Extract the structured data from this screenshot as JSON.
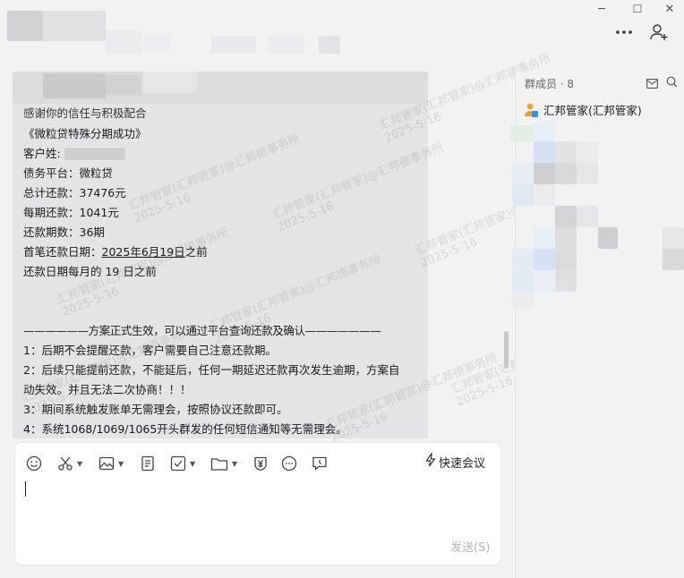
{
  "window": {
    "minimize": "─",
    "maximize": "☐",
    "close": "✕"
  },
  "header": {
    "more_icon": "more-icon",
    "add_member_icon": "add-member-icon"
  },
  "message": {
    "lines": [
      "感谢你的信任与积极配合",
      "《微粒贷特殊分期成功》",
      "客户姓:",
      "债务平台：微粒贷",
      "总计还款：37476元",
      "每期还款：1041元",
      "还款期数：36期",
      "首笔还款日期：",
      "还款日期每月的 19 日之前",
      "——————方案正式生效，可以通过平台查询还款及确认———————",
      "1：后期不会提醒还款，客户需要自己注意还款期。",
      "2：后续只能提前还款，不能延后，任何一期延迟还款再次发生逾期，方案自",
      "动失效。并且无法二次协商！！！",
      "3：期间系统触发账单无需理会，按照协议还款即可。",
      "4：系统1068/1069/1065开头群发的任何短信通知等无需理会。"
    ],
    "first_due_date": "2025年6月19日",
    "first_due_suffix": "之前"
  },
  "watermark": {
    "name": "汇邦管家(汇邦管家)@汇邦德事务所",
    "date": "2025-5-16"
  },
  "sidebar": {
    "title": "群成员 · 8",
    "members": [
      {
        "name": "汇邦管家(汇邦管家)"
      }
    ]
  },
  "composer": {
    "tools": [
      "emoji-icon",
      "scissors-icon",
      "image-icon",
      "document-icon",
      "checkbox-icon",
      "folder-icon",
      "money-icon",
      "chat-bubble-icon",
      "clock-icon"
    ],
    "quick_meeting": "快速会议",
    "send_label": "发送(S)"
  }
}
